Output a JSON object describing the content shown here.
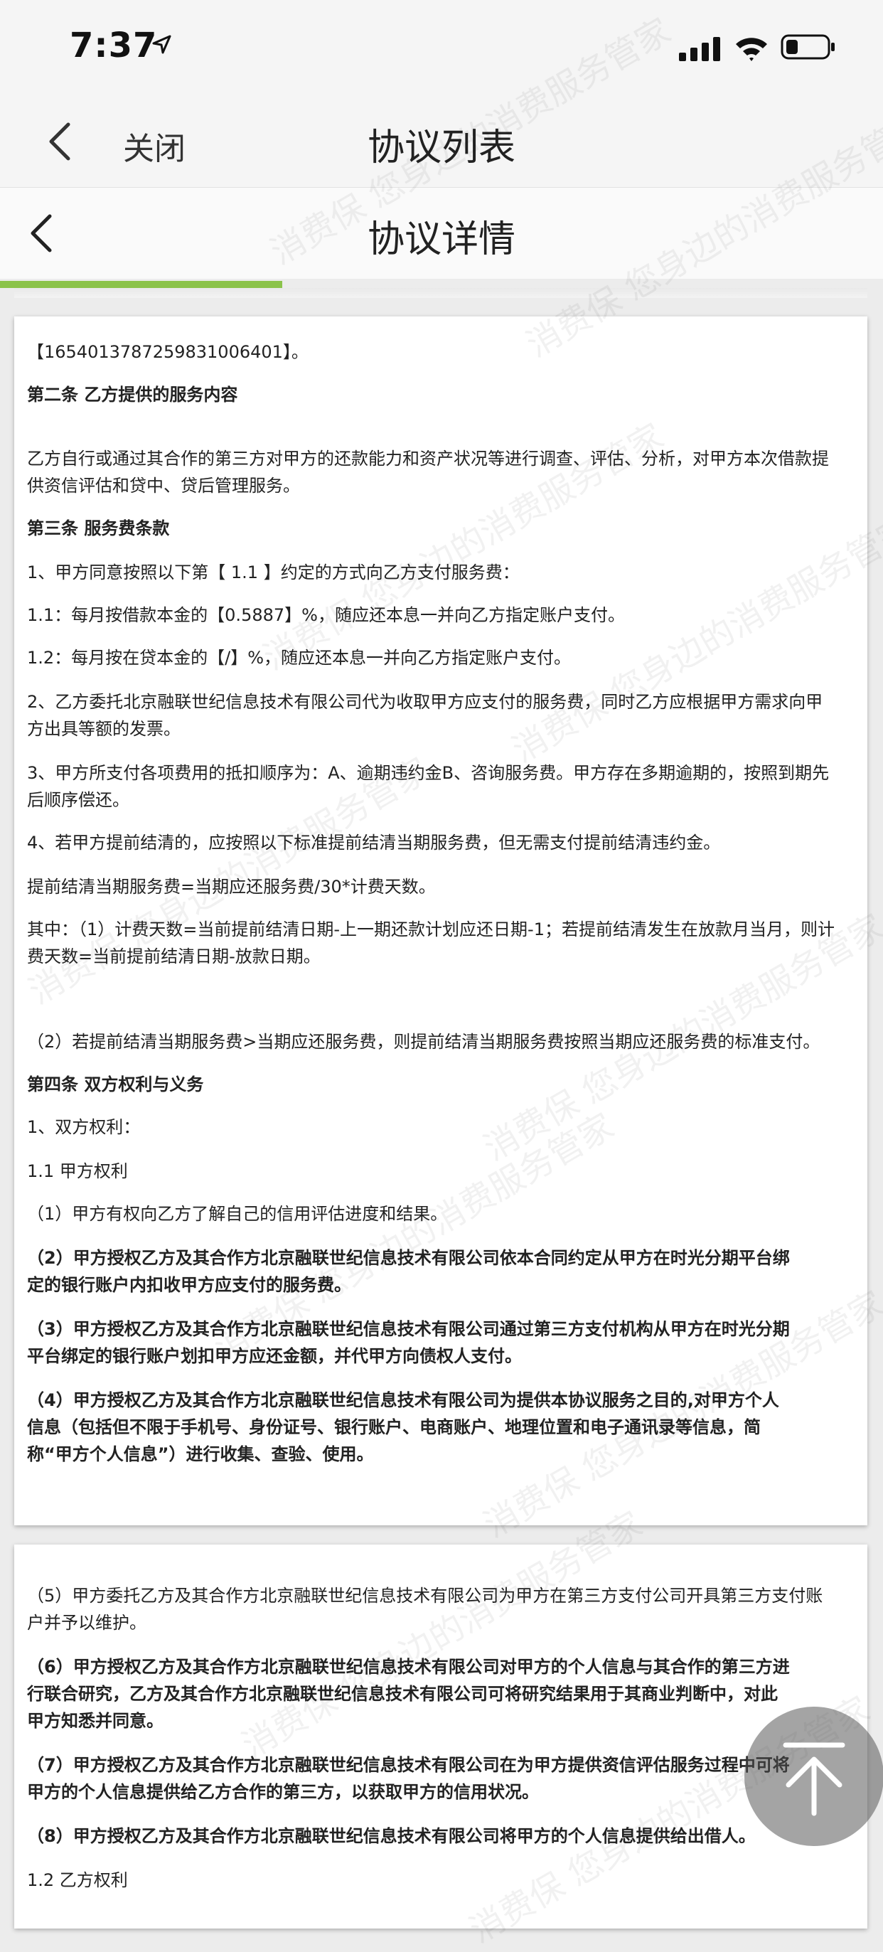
{
  "status_bar": {
    "time": "7:37"
  },
  "nav": {
    "close_label": "关闭",
    "title": "协议列表"
  },
  "detail": {
    "title": "协议详情",
    "progress_fraction": 0.32
  },
  "watermark_text": "消费保 您身边的消费服务管家",
  "card1": {
    "lines": [
      "【1654013787259831006401】。",
      "第二条 乙方提供的服务内容",
      "乙方自行或通过其合作的第三方对甲方的还款能力和资产状况等进行调查、评估、分析，对甲方本次借款提",
      "供资信评估和贷中、贷后管理服务。",
      "第三条 服务费条款",
      "1、甲方同意按照以下第【 1.1 】约定的方式向乙方支付服务费：",
      "1.1：每月按借款本金的【0.5887】%，随应还本息一并向乙方指定账户支付。",
      "1.2：每月按在贷本金的【/】%，随应还本息一并向乙方指定账户支付。",
      "2、乙方委托北京融联世纪信息技术有限公司代为收取甲方应支付的服务费，同时乙方应根据甲方需求向甲",
      "方出具等额的发票。",
      "3、甲方所支付各项费用的抵扣顺序为：A、逾期违约金B、咨询服务费。甲方存在多期逾期的，按照到期先",
      "后顺序偿还。",
      "4、若甲方提前结清的，应按照以下标准提前结清当期服务费，但无需支付提前结清违约金。",
      "提前结清当期服务费=当期应还服务费/30*计费天数。",
      "其中：（1）计费天数=当前提前结清日期-上一期还款计划应还日期-1；若提前结清发生在放款月当月，则计",
      "费天数=当前提前结清日期-放款日期。",
      "（2）若提前结清当期服务费>当期应还服务费，则提前结清当期服务费按照当期应还服务费的标准支付。",
      "第四条 双方权利与义务",
      "1、双方权利：",
      "1.1 甲方权利",
      "（1）甲方有权向乙方了解自己的信用评估进度和结果。",
      "（2）甲方授权乙方及其合作方北京融联世纪信息技术有限公司依本合同约定从甲方在时光分期平台绑",
      "定的银行账户内扣收甲方应支付的服务费。",
      "（3）甲方授权乙方及其合作方北京融联世纪信息技术有限公司通过第三方支付机构从甲方在时光分期",
      "平台绑定的银行账户划扣甲方应还金额，并代甲方向债权人支付。",
      "（4）甲方授权乙方及其合作方北京融联世纪信息技术有限公司为提供本协议服务之目的,对甲方个人",
      "信息（包括但不限于手机号、身份证号、银行账户、电商账户、地理位置和电子通讯录等信息，简",
      "称“甲方个人信息”）进行收集、查验、使用。"
    ]
  },
  "card2": {
    "lines": [
      "（5）甲方委托乙方及其合作方北京融联世纪信息技术有限公司为甲方在第三方支付公司开具第三方支付账",
      "户并予以维护。",
      "（6）甲方授权乙方及其合作方北京融联世纪信息技术有限公司对甲方的个人信息与其合作的第三方进",
      "行联合研究，乙方及其合作方北京融联世纪信息技术有限公司可将研究结果用于其商业判断中，对此",
      "甲方知悉并同意。",
      "（7）甲方授权乙方及其合作方北京融联世纪信息技术有限公司在为甲方提供资信评估服务过程中可将",
      "甲方的个人信息提供给乙方合作的第三方，以获取甲方的信用状况。",
      "（8）甲方授权乙方及其合作方北京融联世纪信息技术有限公司将甲方的个人信息提供给出借人。",
      "1.2 乙方权利"
    ]
  }
}
